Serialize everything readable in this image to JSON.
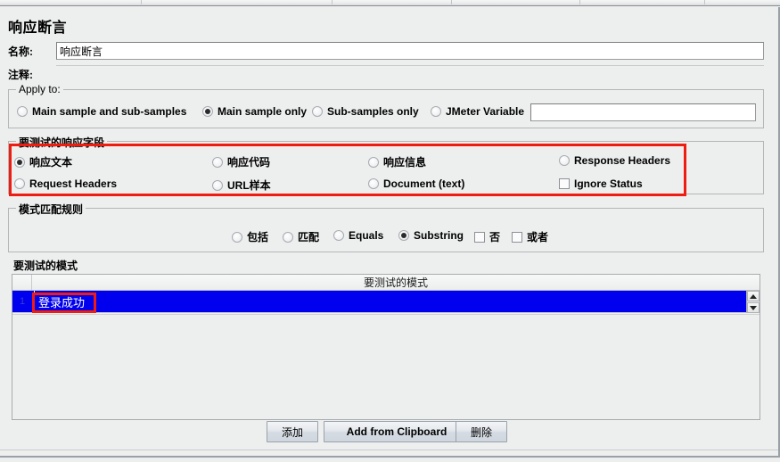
{
  "window": {
    "title": "响应断言"
  },
  "fields": {
    "name_label": "名称:",
    "name_value": "响应断言",
    "comment_label": "注释:",
    "comment_value": "",
    "comment_placeholder": ""
  },
  "apply_to": {
    "title": "Apply to:",
    "options": [
      {
        "label": "Main sample and sub-samples",
        "selected": false
      },
      {
        "label": "Main sample only",
        "selected": true
      },
      {
        "label": "Sub-samples only",
        "selected": false
      },
      {
        "label": "JMeter Variable",
        "selected": false
      }
    ],
    "variable_value": "",
    "variable_placeholder": ""
  },
  "response_field": {
    "title": "要测试的响应字段",
    "highlighted": true,
    "highlight_color": "#ee1c11",
    "options": [
      {
        "label": "响应文本",
        "type": "radio",
        "selected": true
      },
      {
        "label": "响应代码",
        "type": "radio",
        "selected": false
      },
      {
        "label": "响应信息",
        "type": "radio",
        "selected": false
      },
      {
        "label": "Response Headers",
        "type": "radio",
        "selected": false
      },
      {
        "label": "Request Headers",
        "type": "radio",
        "selected": false
      },
      {
        "label": "URL样本",
        "type": "radio",
        "selected": false
      },
      {
        "label": "Document (text)",
        "type": "radio",
        "selected": false
      },
      {
        "label": "Ignore Status",
        "type": "checkbox",
        "selected": false
      }
    ]
  },
  "pattern_rules": {
    "title": "模式匹配规则",
    "options": [
      {
        "label": "包括",
        "type": "radio",
        "selected": false
      },
      {
        "label": "匹配",
        "type": "radio",
        "selected": false
      },
      {
        "label": "Equals",
        "type": "radio",
        "selected": false
      },
      {
        "label": "Substring",
        "type": "radio",
        "selected": true
      },
      {
        "label": "否",
        "type": "checkbox",
        "selected": false
      },
      {
        "label": "或者",
        "type": "checkbox",
        "selected": false
      }
    ]
  },
  "patterns": {
    "title": "要测试的模式",
    "column_header": "要测试的模式",
    "rows": [
      {
        "num": "1",
        "value": "登录成功",
        "selected": true,
        "highlighted": true
      }
    ],
    "selection_color": "#0000ef",
    "highlight_color": "#ee1c11"
  },
  "buttons": {
    "add": "添加",
    "add_from_clipboard": "Add from Clipboard",
    "delete": "删除"
  },
  "scrollbar": {
    "up": "▲",
    "down": "▼"
  }
}
